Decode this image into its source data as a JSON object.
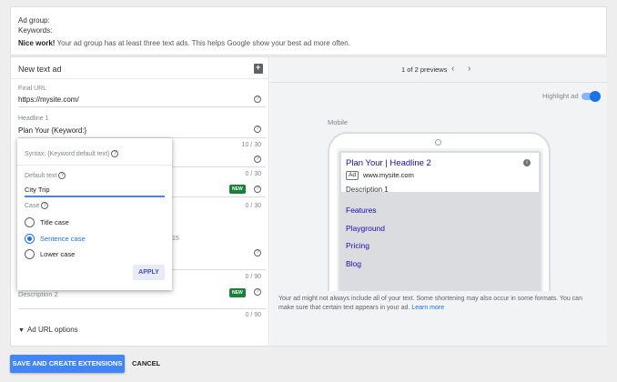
{
  "header": {
    "ad_group_label": "Ad group:",
    "keywords_label": "Keywords:",
    "nice_work": "Nice work!",
    "nice_work_text": " Your ad group has at least three text ads. This helps Google show your best ad more often."
  },
  "form": {
    "title": "New text ad",
    "final_url_label": "Final URL",
    "final_url_value": "https://mysite.com/",
    "headline1_label": "Headline 1",
    "headline1_value": "Plan Your {Keyword:}",
    "counts": [
      "10 / 30",
      "0 / 30",
      "0 / 30",
      "0 / 90",
      "0 / 90"
    ],
    "partial_15": "15",
    "description2_label": "Description 2",
    "new_badge": "NEW",
    "ad_url_options": "Ad URL options"
  },
  "popup": {
    "syntax": "Syntax: {Keyword:default text}",
    "default_text_label": "Default text",
    "default_text_value": "City Trip",
    "case_label": "Case",
    "options": [
      {
        "label": "Title case",
        "selected": false
      },
      {
        "label": "Sentence case",
        "selected": true
      },
      {
        "label": "Lower case",
        "selected": false
      }
    ],
    "apply": "APPLY"
  },
  "preview": {
    "nav_text": "1 of 2 previews",
    "highlight_label": "Highlight ad",
    "highlight_on": true,
    "mobile_label": "Mobile",
    "ad_headline": "Plan Your | Headline 2",
    "ad_badge": "Ad",
    "ad_url": "www.mysite.com",
    "ad_description": "Description 1",
    "sitelinks": [
      "Features",
      "Playground",
      "Pricing",
      "Blog"
    ],
    "disclaimer": "Your ad might not always include all of your text. Some shortening may also occur in some formats. You can make sure that certain text appears in your ad.",
    "learn_more": "Learn more"
  },
  "actions": {
    "save": "SAVE AND CREATE EXTENSIONS",
    "cancel": "CANCEL"
  },
  "colors": {
    "primary": "#4285f4",
    "link": "#1a0dab",
    "new_badge": "#188038"
  },
  "icons": [
    "copy-ad-icon",
    "help-icon",
    "chevron-down-icon",
    "chevron-left-icon",
    "chevron-right-icon",
    "info-icon"
  ]
}
